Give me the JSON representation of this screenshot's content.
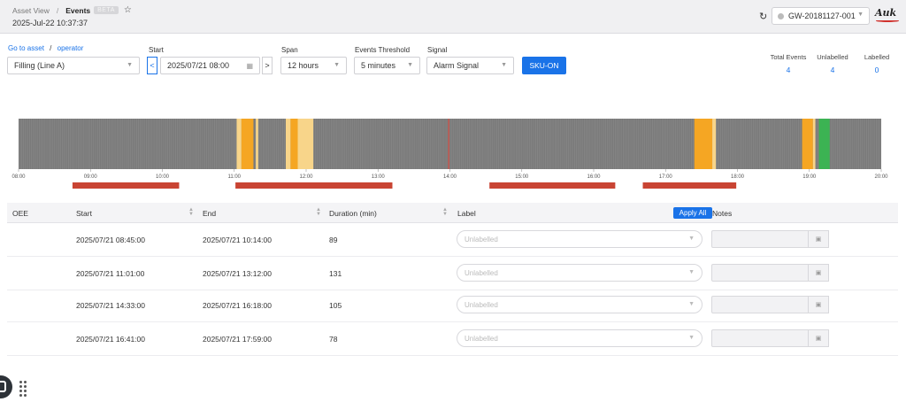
{
  "topbar": {
    "breadcrumb_root": "Asset View",
    "breadcrumb_separator": "/",
    "breadcrumb_current": "Events",
    "beta_badge": "BETA",
    "datetime": "2025-Jul-22 10:37:37",
    "gateway": "GW-20181127-001",
    "logo_text": "Auk"
  },
  "filters": {
    "go_to_asset": "Go to asset",
    "separator": "/",
    "operator": "operator",
    "asset_value": "Filling (Line A)",
    "start_label": "Start",
    "start_value": "2025/07/21 08:00",
    "prev_arrow": "<",
    "next_arrow": ">",
    "span_label": "Span",
    "span_value": "12 hours",
    "threshold_label": "Events Threshold",
    "threshold_value": "5 minutes",
    "signal_label": "Signal",
    "signal_value": "Alarm Signal",
    "sku_button": "SKU-ON"
  },
  "stats": {
    "total_label": "Total Events",
    "total_value": "4",
    "unlabelled_label": "Unlabelled",
    "unlabelled_value": "4",
    "labelled_label": "Labelled",
    "labelled_value": "0"
  },
  "timeline": {
    "ticks": [
      "08:00",
      "09:00",
      "10:00",
      "11:00",
      "12:00",
      "13:00",
      "14:00",
      "15:00",
      "16:00",
      "17:00",
      "18:00",
      "19:00",
      "20:00"
    ],
    "colors": {
      "base": "#777777",
      "amber": "#f5a623",
      "light": "#f8d58a",
      "green": "#3cb353",
      "marker": "#e03a2f",
      "event": "#c94433"
    },
    "segments": [
      {
        "start": "11:02",
        "end": "11:06",
        "color": "light"
      },
      {
        "start": "11:06",
        "end": "11:16",
        "color": "amber"
      },
      {
        "start": "11:18",
        "end": "11:20",
        "color": "light"
      },
      {
        "start": "11:43",
        "end": "11:47",
        "color": "light"
      },
      {
        "start": "11:47",
        "end": "11:53",
        "color": "amber"
      },
      {
        "start": "11:53",
        "end": "12:06",
        "color": "light"
      },
      {
        "start": "17:24",
        "end": "17:39",
        "color": "amber"
      },
      {
        "start": "17:39",
        "end": "17:42",
        "color": "light"
      },
      {
        "start": "18:54",
        "end": "19:03",
        "color": "amber"
      },
      {
        "start": "19:03",
        "end": "19:05",
        "color": "light"
      },
      {
        "start": "19:08",
        "end": "19:17",
        "color": "green"
      }
    ],
    "now_marker": "13:59",
    "events": [
      {
        "start": "08:45",
        "end": "10:14"
      },
      {
        "start": "11:01",
        "end": "13:12"
      },
      {
        "start": "14:33",
        "end": "16:18"
      },
      {
        "start": "16:41",
        "end": "17:59"
      }
    ]
  },
  "table": {
    "headers": {
      "oee": "OEE",
      "start": "Start",
      "end": "End",
      "duration": "Duration (min)",
      "label": "Label",
      "notes": "Notes"
    },
    "apply_all": "Apply All",
    "label_placeholder": "Unlabelled",
    "rows": [
      {
        "start": "2025/07/21 08:45:00",
        "end": "2025/07/21 10:14:00",
        "duration": "89"
      },
      {
        "start": "2025/07/21 11:01:00",
        "end": "2025/07/21 13:12:00",
        "duration": "131"
      },
      {
        "start": "2025/07/21 14:33:00",
        "end": "2025/07/21 16:18:00",
        "duration": "105"
      },
      {
        "start": "2025/07/21 16:41:00",
        "end": "2025/07/21 17:59:00",
        "duration": "78"
      }
    ]
  }
}
